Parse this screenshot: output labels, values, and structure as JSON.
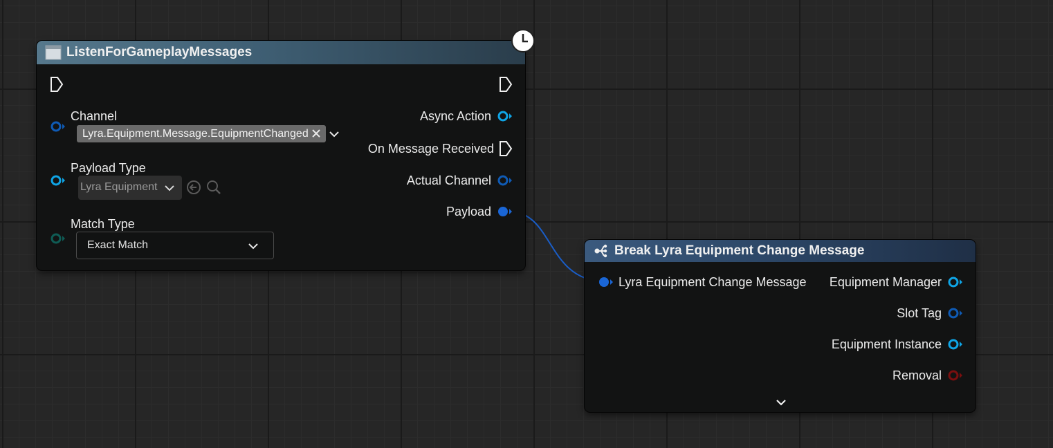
{
  "listen_node": {
    "title": "ListenForGameplayMessages",
    "inputs": {
      "channel_label": "Channel",
      "channel_value": "Lyra.Equipment.Message.EquipmentChanged",
      "payload_type_label": "Payload Type",
      "payload_type_value": "Lyra Equipment",
      "match_type_label": "Match Type",
      "match_type_value": "Exact Match"
    },
    "outputs": {
      "async_action": "Async Action",
      "on_message_received": "On Message Received",
      "actual_channel": "Actual Channel",
      "payload": "Payload"
    }
  },
  "break_node": {
    "title": "Break Lyra Equipment Change Message",
    "input": "Lyra Equipment Change Message",
    "outputs": {
      "equipment_manager": "Equipment Manager",
      "slot_tag": "Slot Tag",
      "equipment_instance": "Equipment Instance",
      "removal": "Removal"
    }
  },
  "colors": {
    "object_pin": "#0fa5e6",
    "struct_pin": "#1a66d6",
    "tag_pin": "#0f5bb5",
    "enum_pin": "#0f5c55",
    "bool_pin": "#7a0f0f",
    "wire": "#1a66d6"
  }
}
